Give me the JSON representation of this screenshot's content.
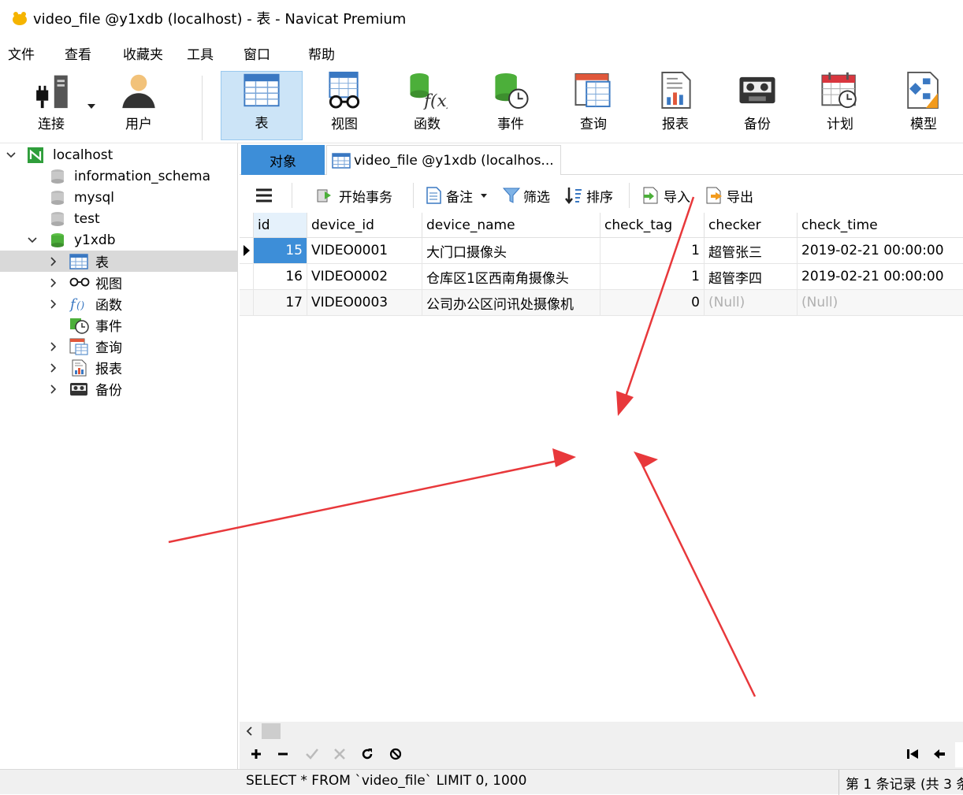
{
  "window": {
    "title": "video_file @y1xdb (localhost) - 表 - Navicat Premium"
  },
  "menu": [
    "文件",
    "查看",
    "收藏夹",
    "工具",
    "窗口",
    "帮助"
  ],
  "toolbar": {
    "connect": "连接",
    "user": "用户",
    "table": "表",
    "view": "视图",
    "function": "函数",
    "event": "事件",
    "query": "查询",
    "report": "报表",
    "backup": "备份",
    "schedule": "计划",
    "model": "模型"
  },
  "tree": {
    "localhost": "localhost",
    "information_schema": "information_schema",
    "mysql": "mysql",
    "test": "test",
    "y1xdb": "y1xdb",
    "tables": "表",
    "views": "视图",
    "functions": "函数",
    "events": "事件",
    "queries": "查询",
    "reports": "报表",
    "backups": "备份"
  },
  "tabs": {
    "objects": "对象",
    "file": "video_file @y1xdb (localhos..."
  },
  "subtoolbar": {
    "begin_tx": "开始事务",
    "note": "备注",
    "filter": "筛选",
    "sort": "排序",
    "import": "导入",
    "export": "导出"
  },
  "table": {
    "columns": [
      "id",
      "device_id",
      "device_name",
      "check_tag",
      "checker",
      "check_time"
    ],
    "rows": [
      [
        "15",
        "VIDEO0001",
        "大门口摄像头",
        "1",
        "超管张三",
        "2019-02-21 00:00:00"
      ],
      [
        "16",
        "VIDEO0002",
        "仓库区1区西南角摄像头",
        "1",
        "超管李四",
        "2019-02-21 00:00:00"
      ],
      [
        "17",
        "VIDEO0003",
        "公司办公区问讯处摄像机",
        "0",
        "(Null)",
        "(Null)"
      ]
    ]
  },
  "status": {
    "sql": "SELECT * FROM `video_file` LIMIT 0, 1000",
    "records": "第 1 条记录 (共 3 条"
  },
  "colors": {
    "accent": "#3d8ed8",
    "selected_tool": "#cce4f7",
    "annotation_arrow": "#e8383b"
  }
}
